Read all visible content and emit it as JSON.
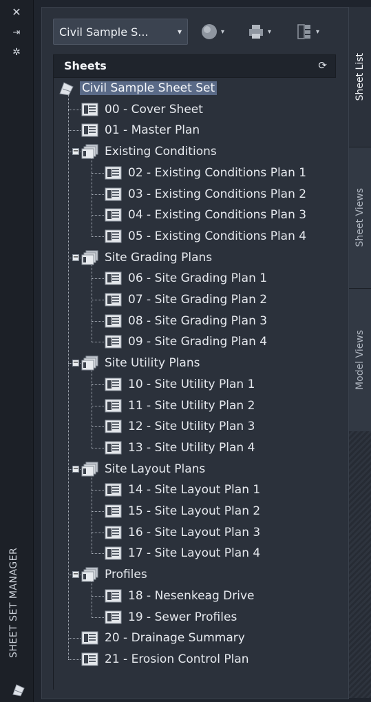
{
  "titlebar": {
    "close_glyph": "✕",
    "pin_glyph": "⇥",
    "settings_glyph": "✲",
    "title": "SHEET SET MANAGER"
  },
  "toolbar": {
    "sheet_set_dropdown_value": "Civil Sample S...",
    "dropdown_arrow": "▾",
    "publish_caret": "▾",
    "plot_caret": "▾",
    "properties_caret": "▾"
  },
  "sheets_header": {
    "label": "Sheets",
    "refresh_glyph": "⟳"
  },
  "tree": {
    "root": "Civil Sample Sheet Set",
    "items": [
      {
        "type": "sheet",
        "label": "00 - Cover Sheet"
      },
      {
        "type": "sheet",
        "label": "01 - Master Plan"
      },
      {
        "type": "subset",
        "label": "Existing Conditions",
        "children": [
          "02 - Existing Conditions Plan 1",
          "03 - Existing Conditions Plan 2",
          "04 - Existing Conditions Plan 3",
          "05 - Existing Conditions Plan 4"
        ]
      },
      {
        "type": "subset",
        "label": "Site Grading Plans",
        "children": [
          "06 - Site Grading Plan 1",
          "07 - Site Grading Plan 2",
          "08 - Site Grading Plan 3",
          "09 - Site Grading Plan 4"
        ]
      },
      {
        "type": "subset",
        "label": "Site Utility Plans",
        "children": [
          "10 - Site Utility Plan 1",
          "11 - Site Utility Plan 2",
          "12 - Site Utility Plan 3",
          "13 - Site Utility Plan 4"
        ]
      },
      {
        "type": "subset",
        "label": "Site Layout Plans",
        "children": [
          "14 - Site Layout Plan 1",
          "15 - Site Layout Plan 2",
          "16 - Site Layout Plan 3",
          "17 - Site Layout Plan 4"
        ]
      },
      {
        "type": "subset",
        "label": "Profiles",
        "children": [
          "18 - Nesenkeag Drive",
          "19 - Sewer Profiles"
        ]
      },
      {
        "type": "sheet",
        "label": "20 - Drainage Summary"
      },
      {
        "type": "sheet",
        "label": "21 - Erosion Control Plan"
      }
    ]
  },
  "tabs": {
    "sheet_list": "Sheet List",
    "sheet_views": "Sheet Views",
    "model_views": "Model Views"
  },
  "colors": {
    "panel_bg": "#2b313b",
    "selection": "#5a6a87",
    "header_bg": "#1f242c"
  }
}
